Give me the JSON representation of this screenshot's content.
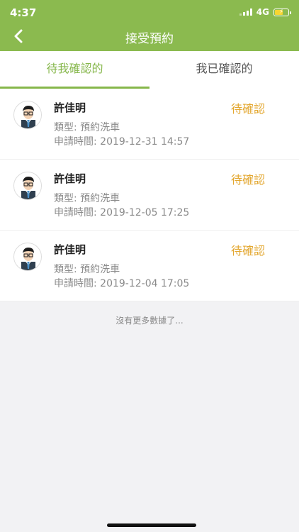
{
  "status_bar": {
    "time": "4:37",
    "network": "4G"
  },
  "header": {
    "title": "接受預約"
  },
  "tabs": [
    {
      "label": "待我確認的",
      "active": true
    },
    {
      "label": "我已確認的",
      "active": false
    }
  ],
  "reservations": [
    {
      "name": "許佳明",
      "status": "待確認",
      "type": "類型:   預約洗車",
      "time": "申請時間:   2019-12-31 14:57"
    },
    {
      "name": "許佳明",
      "status": "待確認",
      "type": "類型:   預約洗車",
      "time": "申請時間:   2019-12-05 17:25"
    },
    {
      "name": "許佳明",
      "status": "待確認",
      "type": "類型:   預約洗車",
      "time": "申請時間:   2019-12-04 17:05"
    }
  ],
  "footer": {
    "no_more": "沒有更多數據了..."
  },
  "colors": {
    "brand": "#8bba4f",
    "accent": "#86b74b",
    "pending": "#e3a72f"
  }
}
